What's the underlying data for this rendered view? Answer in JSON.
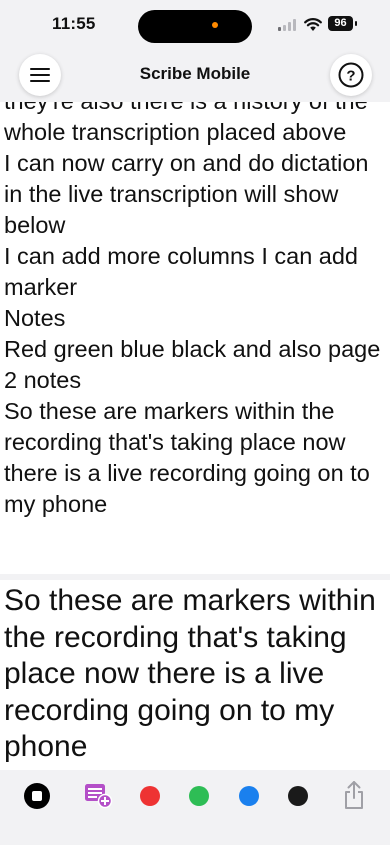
{
  "status_bar": {
    "time": "11:55",
    "battery": "96"
  },
  "header": {
    "title": "Scribe Mobile",
    "menu_icon": "hamburger-menu-icon",
    "help_icon": "question-circle-icon"
  },
  "history": {
    "text": "they're also there is a history of the whole transcription placed above\nI can now carry on and do dictation in the live transcription will show below\nI can add more columns I can add marker\nNotes\nRed green blue black and also page 2 notes\nSo these are markers within the recording that's taking place now there is a live recording going on to my phone"
  },
  "live": {
    "text": "So these are markers within the recording that's taking place now there is a live recording going on to my phone"
  },
  "toolbar": {
    "tools": [
      {
        "name": "stop-recording-icon",
        "color": "#000000"
      },
      {
        "name": "add-note-icon",
        "color": "#b44fc8"
      },
      {
        "name": "marker-red",
        "color": "#ee3333"
      },
      {
        "name": "marker-green",
        "color": "#2ebd55"
      },
      {
        "name": "marker-blue",
        "color": "#1a80ee"
      },
      {
        "name": "marker-black",
        "color": "#1a1a1a"
      },
      {
        "name": "share-icon",
        "color": "#a0a0a6"
      }
    ]
  }
}
